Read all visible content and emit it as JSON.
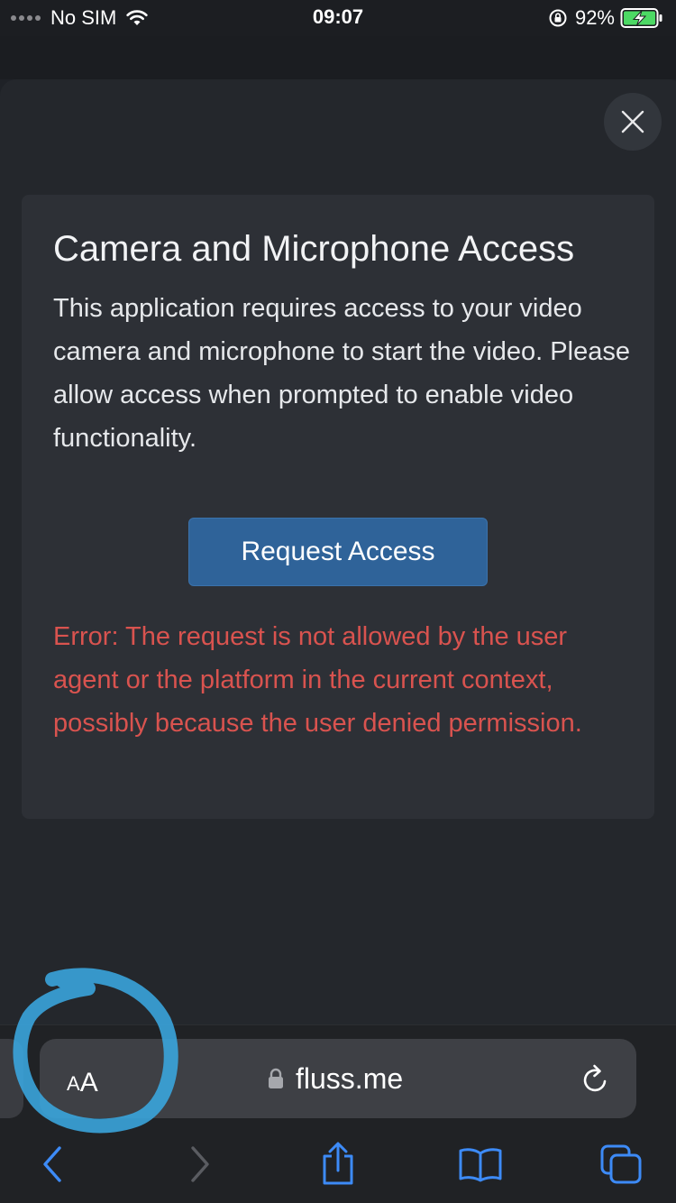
{
  "status_bar": {
    "carrier": "No SIM",
    "time": "09:07",
    "battery_percent": "92%"
  },
  "dialog": {
    "title": "Camera and Microphone Access",
    "body": "This application requires access to your video camera and microphone to start the video. Please allow access when prompted to enable video functionality.",
    "request_button_label": "Request Access",
    "error": "Error: The request is not allowed by the user agent or the platform in the current context, possibly because the user denied permission."
  },
  "browser": {
    "aa_small": "A",
    "aa_big": "A",
    "url": "fluss.me"
  },
  "colors": {
    "accent_button": "#2f6399",
    "error": "#d9534f",
    "toolbar_icon": "#3d8bf7",
    "annotation": "#3aa7e0"
  },
  "icons": {
    "close": "close-icon",
    "lock": "lock-icon",
    "reload": "reload-icon",
    "back": "back-icon",
    "forward": "forward-icon",
    "share": "share-icon",
    "bookmarks": "bookmarks-icon",
    "tabs": "tabs-icon"
  }
}
